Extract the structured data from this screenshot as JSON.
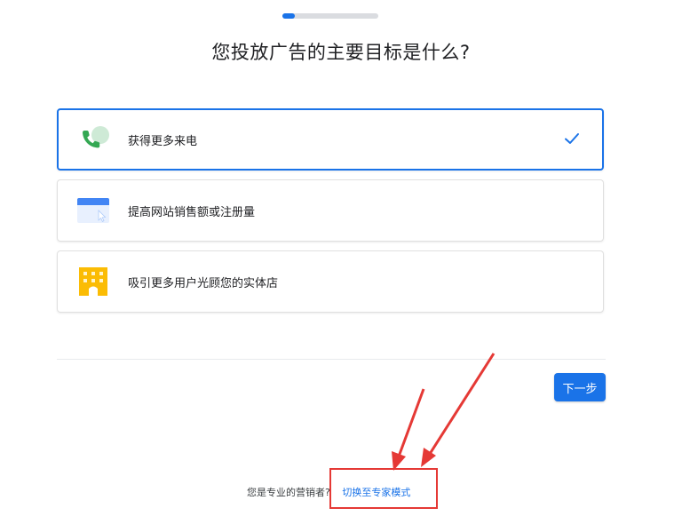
{
  "progress": {
    "fraction": 0.13
  },
  "title": "您投放广告的主要目标是什么?",
  "options": [
    {
      "label": "获得更多来电",
      "icon": "phone-call-icon",
      "selected": true
    },
    {
      "label": "提高网站销售额或注册量",
      "icon": "website-window-icon",
      "selected": false
    },
    {
      "label": "吸引更多用户光顾您的实体店",
      "icon": "storefront-icon",
      "selected": false
    }
  ],
  "next_button": {
    "label": "下一步"
  },
  "footer": {
    "question": "您是专业的营销者?",
    "expert_link": "切换至专家模式"
  },
  "colors": {
    "accent": "#1a73e8",
    "annotation": "#e53935",
    "phone_green": "#34a853",
    "store_yellow": "#fbbc04"
  }
}
